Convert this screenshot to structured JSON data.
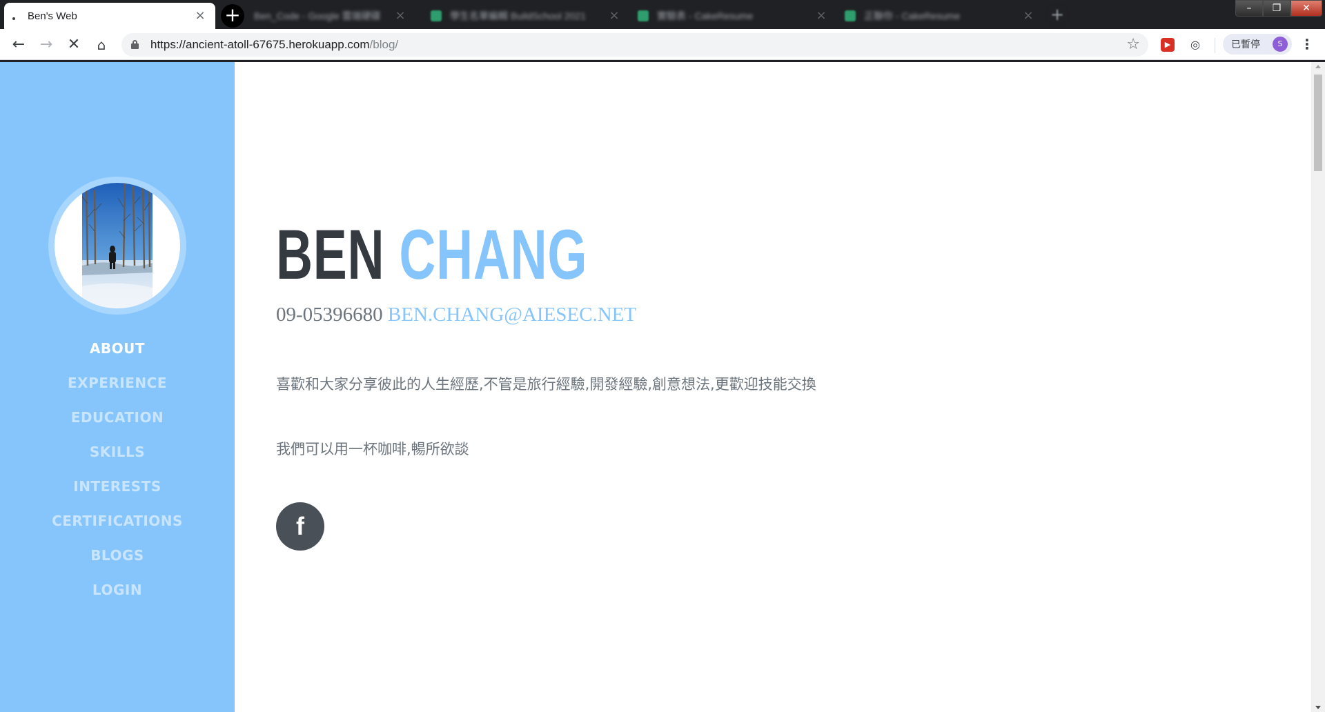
{
  "browser": {
    "active_tab": {
      "title": "Ben's Web"
    },
    "inactive_tabs": [
      {
        "title": "Ben_Code - Google 雲端硬碟"
      },
      {
        "title": "學生名單編輯 BuildSchool 2021"
      },
      {
        "title": "實驗表 - CakeResume"
      },
      {
        "title": "正聯你 - CakeResume"
      }
    ],
    "url": {
      "host": "https://ancient-atoll-67675.herokuapp.com",
      "path": "/blog/"
    },
    "profile_status": "已暫停",
    "profile_initial": "S",
    "icons": {
      "back": "back-arrow-icon",
      "forward": "forward-arrow-icon",
      "stop": "stop-loading-icon",
      "home": "home-icon",
      "lock": "lock-icon",
      "star": "bookmark-star-icon",
      "menu": "kebab-menu-icon"
    }
  },
  "sidebar": {
    "accent": "#86c5fb",
    "nav": [
      {
        "label": "ABOUT",
        "active": true
      },
      {
        "label": "EXPERIENCE",
        "active": false
      },
      {
        "label": "EDUCATION",
        "active": false
      },
      {
        "label": "SKILLS",
        "active": false
      },
      {
        "label": "INTERESTS",
        "active": false
      },
      {
        "label": "CERTIFICATIONS",
        "active": false
      },
      {
        "label": "BLOGS",
        "active": false
      },
      {
        "label": "LOGIN",
        "active": false
      }
    ]
  },
  "main": {
    "first_name": "BEN",
    "last_name": "CHANG",
    "phone": "09-05396680",
    "email": "BEN.CHANG@AIESEC.NET",
    "lead_1": "喜歡和大家分享彼此的人生經歷,不管是旅行經驗,開發經驗,創意想法,更歡迎技能交換",
    "lead_2": "我們可以用一杯咖啡,暢所欲談",
    "social_icon": "facebook-icon",
    "social_glyph": "f"
  }
}
